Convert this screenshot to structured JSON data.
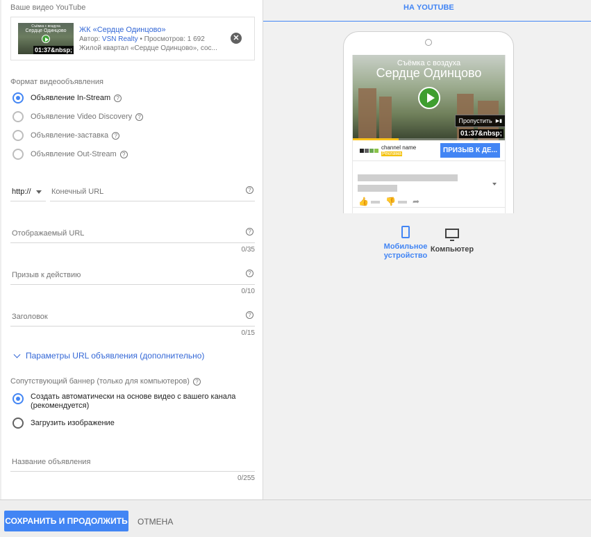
{
  "video_section": {
    "label": "Ваше видео YouTube",
    "thumb_line1": "Съёмка с воздуха",
    "thumb_line2": "Сердце Одинцово",
    "duration": "01:37&nbsp;",
    "title": "ЖК «Сердце Одинцово»",
    "author_prefix": "Автор: ",
    "author": "VSN Realty",
    "views": " • Просмотров: 1 692",
    "description": "Жилой квартал «Сердце Одинцово», сос..."
  },
  "format": {
    "label": "Формат видеообъявления",
    "options": [
      {
        "label": "Объявление In-Stream",
        "selected": true
      },
      {
        "label": "Объявление Video Discovery",
        "selected": false
      },
      {
        "label": "Объявление-заставка",
        "selected": false
      },
      {
        "label": "Объявление Out-Stream",
        "selected": false
      }
    ]
  },
  "fields": {
    "protocol": "http://",
    "final_url": {
      "placeholder": "Конечный URL"
    },
    "display_url": {
      "placeholder": "Отображаемый URL",
      "count": "0/35"
    },
    "call_to_action": {
      "placeholder": "Призыв к действию",
      "count": "0/10"
    },
    "headline": {
      "placeholder": "Заголовок",
      "count": "0/15"
    },
    "url_params": "Параметры URL объявления (дополнительно)",
    "ad_name": {
      "placeholder": "Название объявления",
      "count": "0/255"
    }
  },
  "banner": {
    "label": "Сопутствующий баннер (только для компьютеров)",
    "options": [
      {
        "label": "Создать автоматически на основе видео с вашего канала",
        "label2": "(рекомендуется)",
        "selected": true
      },
      {
        "label": "Загрузить изображение",
        "selected": false
      }
    ]
  },
  "preview": {
    "tab": "НА YOUTUBE",
    "video_line1": "Съёмка с воздуха",
    "video_line2": "Сердце Одинцово",
    "skip": "Пропустить",
    "duration": "01:37&nbsp;",
    "progress": 0.3,
    "channel_name": "channel name",
    "ad_badge": "Реклама",
    "cta": "ПРИЗЫВ К ДЕ...",
    "devices": [
      {
        "label": "Мобильное",
        "label2": "устройство",
        "icon": "smartphone-icon",
        "active": true,
        "color": "#4285f4"
      },
      {
        "label": "Компьютер",
        "icon": "desktop-icon",
        "active": false,
        "color": "#424242"
      }
    ]
  },
  "actions": {
    "save": "СОХРАНИТЬ И ПРОДОЛЖИТЬ",
    "cancel": "ОТМЕНА"
  },
  "colors": {
    "accent": "#4285f4",
    "link": "#3367d6",
    "badge": "#f4c20d"
  }
}
